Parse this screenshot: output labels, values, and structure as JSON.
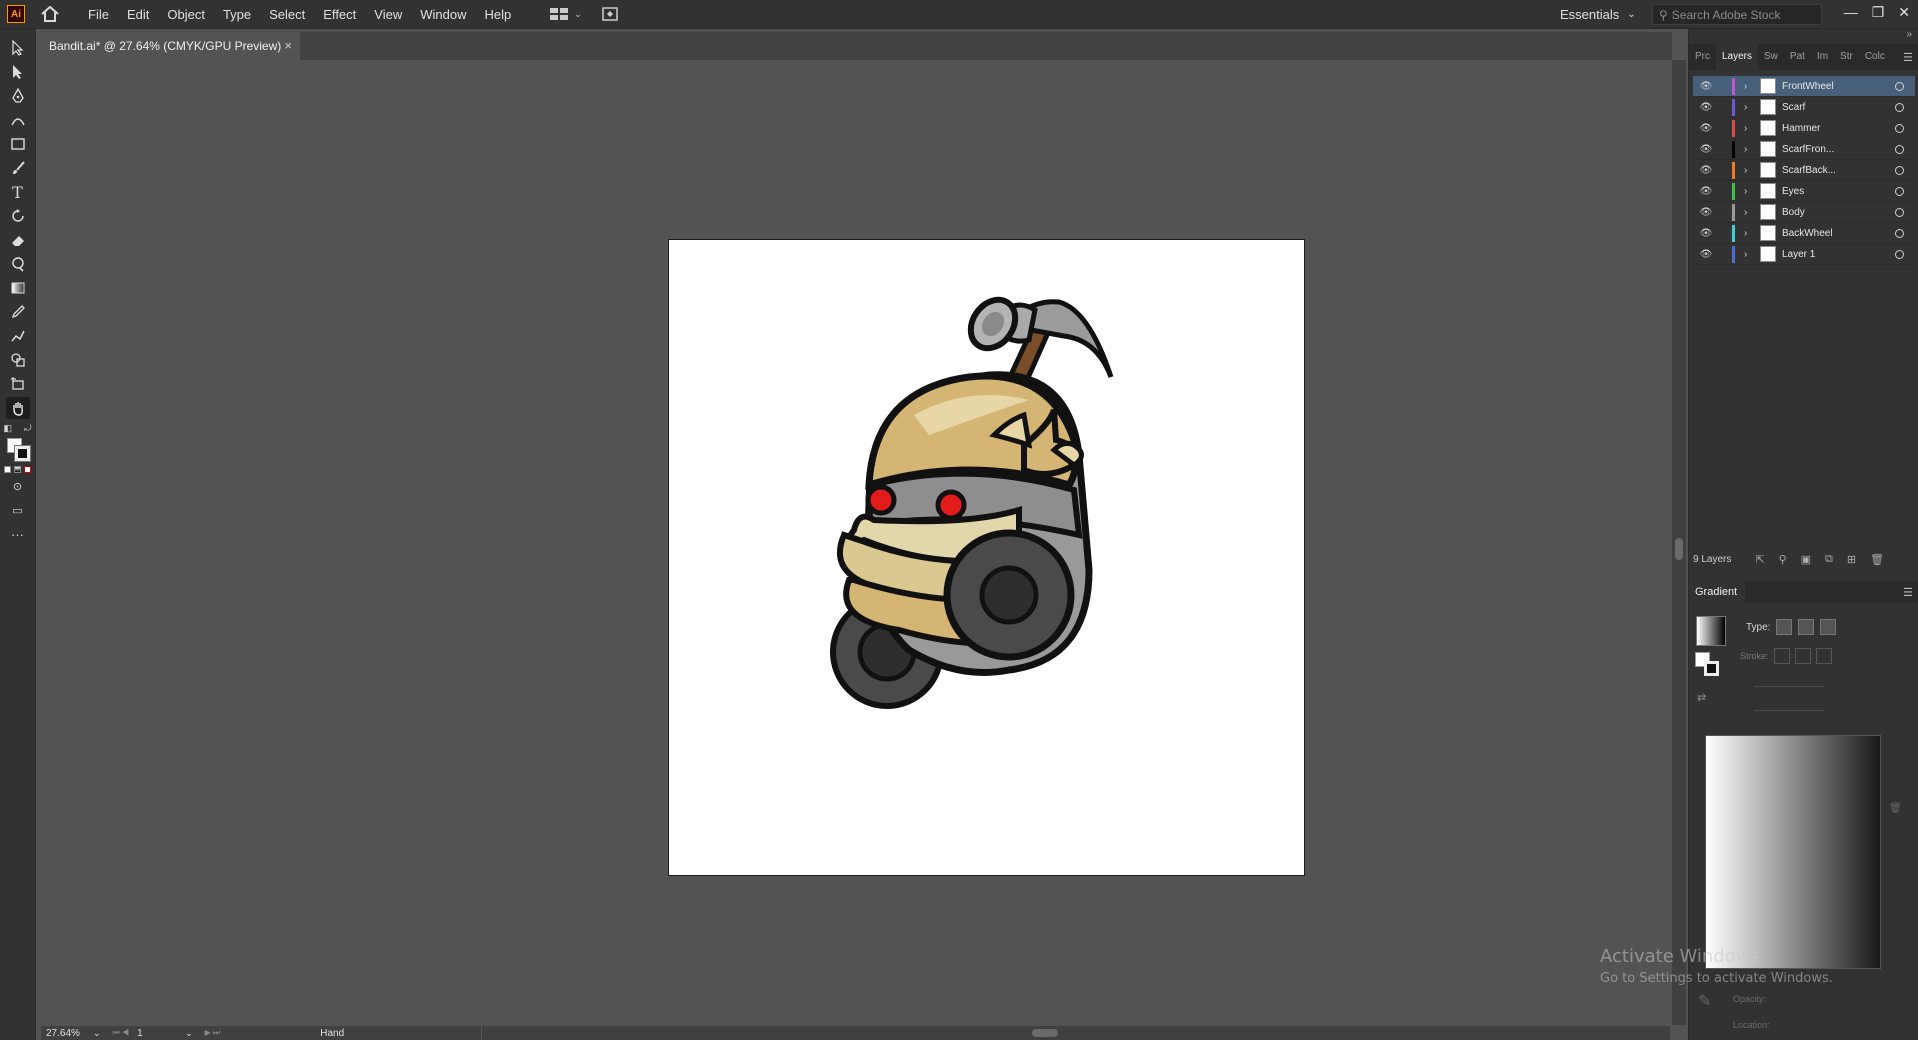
{
  "app": {
    "logo": "Ai",
    "menu": [
      "File",
      "Edit",
      "Object",
      "Type",
      "Select",
      "Effect",
      "View",
      "Window",
      "Help"
    ],
    "workspace": "Essentials",
    "search_placeholder": "Search Adobe Stock",
    "window_controls": [
      "—",
      "❐",
      "✕"
    ]
  },
  "document": {
    "tab_title": "Bandit.ai* @ 27.64% (CMYK/GPU Preview)",
    "close_glyph": "×"
  },
  "panels": {
    "tabs": [
      "Prc",
      "Layers",
      "Sw",
      "Pat",
      "Im",
      "Str",
      "Colc"
    ],
    "active_tab": "Layers",
    "layers": [
      {
        "name": "FrontWheel",
        "color": "#c552d6",
        "selected": true
      },
      {
        "name": "Scarf",
        "color": "#6f5ad6",
        "selected": false
      },
      {
        "name": "Hammer",
        "color": "#d84b4b",
        "selected": false
      },
      {
        "name": "ScarfFron...",
        "color": "#000000",
        "selected": false
      },
      {
        "name": "ScarfBack...",
        "color": "#f07a20",
        "selected": false
      },
      {
        "name": "Eyes",
        "color": "#3ac44a",
        "selected": false
      },
      {
        "name": "Body",
        "color": "#9a9a9a",
        "selected": false
      },
      {
        "name": "BackWheel",
        "color": "#3fd0d6",
        "selected": false
      },
      {
        "name": "Layer 1",
        "color": "#4d6bd6",
        "selected": false
      }
    ],
    "layers_count": "9 Layers",
    "gradient": {
      "title": "Gradient",
      "type_label": "Type:",
      "stroke_label": "Stroke:",
      "opacity_label": "Opacity:",
      "location_label": "Location:"
    }
  },
  "status": {
    "zoom": "27.64%",
    "page": "1",
    "tool": "Hand"
  },
  "watermark": {
    "line1": "Activate Windows",
    "line2": "Go to Settings to activate Windows."
  }
}
